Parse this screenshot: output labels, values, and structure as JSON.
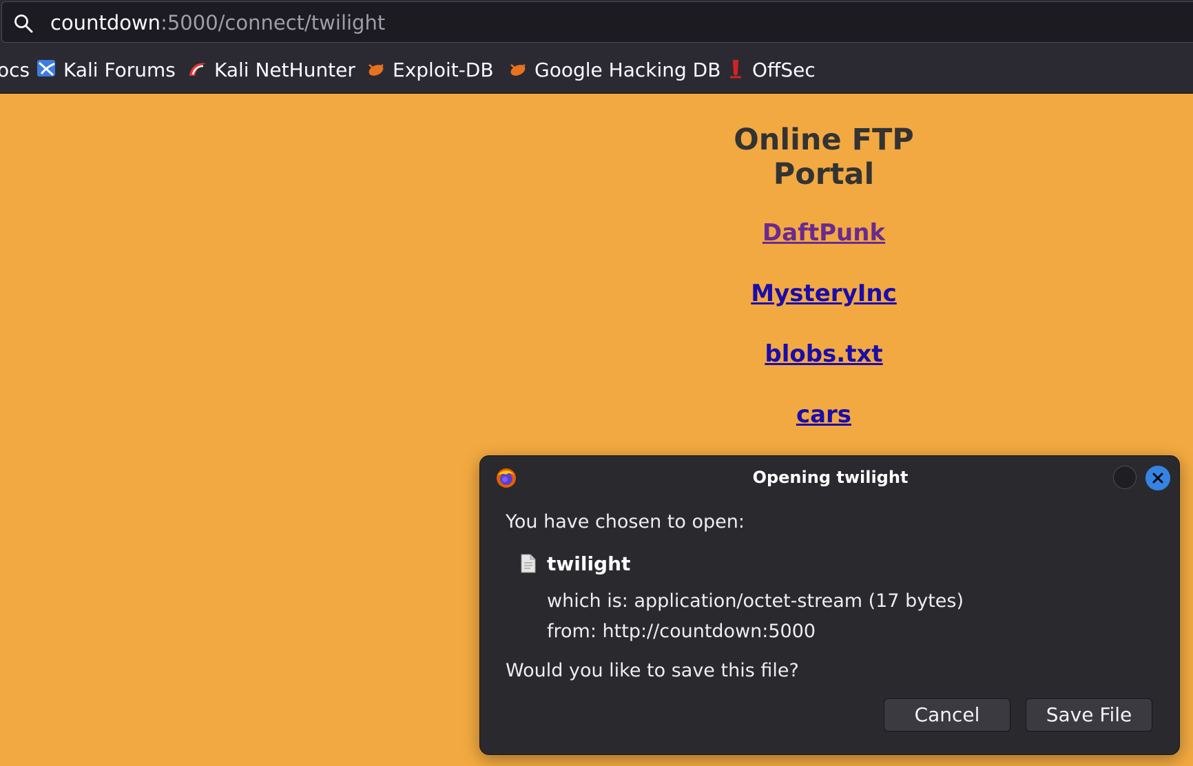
{
  "urlbar": {
    "host": "countdown",
    "rest": ":5000/connect/twilight",
    "icon": "search-icon"
  },
  "bookmarks": [
    {
      "label": "ocs",
      "icon": ""
    },
    {
      "label": "Kali Forums",
      "icon": "kali-forums-icon"
    },
    {
      "label": "Kali NetHunter",
      "icon": "kali-nethunter-icon"
    },
    {
      "label": "Exploit-DB",
      "icon": "exploit-db-icon"
    },
    {
      "label": "Google Hacking DB",
      "icon": "ghdb-icon"
    },
    {
      "label": "OffSec",
      "icon": "offsec-icon"
    }
  ],
  "page": {
    "background": "#f2a941",
    "title": "Online FTP Portal",
    "links": [
      {
        "label": "DaftPunk",
        "visited": true
      },
      {
        "label": "MysteryInc",
        "visited": false
      },
      {
        "label": "blobs.txt",
        "visited": false
      },
      {
        "label": "cars",
        "visited": false
      }
    ]
  },
  "dialog": {
    "title": "Opening twilight",
    "app_icon": "firefox-icon",
    "chosen_label": "You have chosen to open:",
    "file_icon": "document-icon",
    "filename": "twilight",
    "which_is_label": "which is:",
    "which_is_value": "application/octet-stream (17 bytes)",
    "from_label": "from:",
    "from_value": "http://countdown:5000",
    "question": "Would you like to save this file?",
    "cancel_label": "Cancel",
    "save_label": "Save File",
    "close_color": "#3584e4"
  }
}
